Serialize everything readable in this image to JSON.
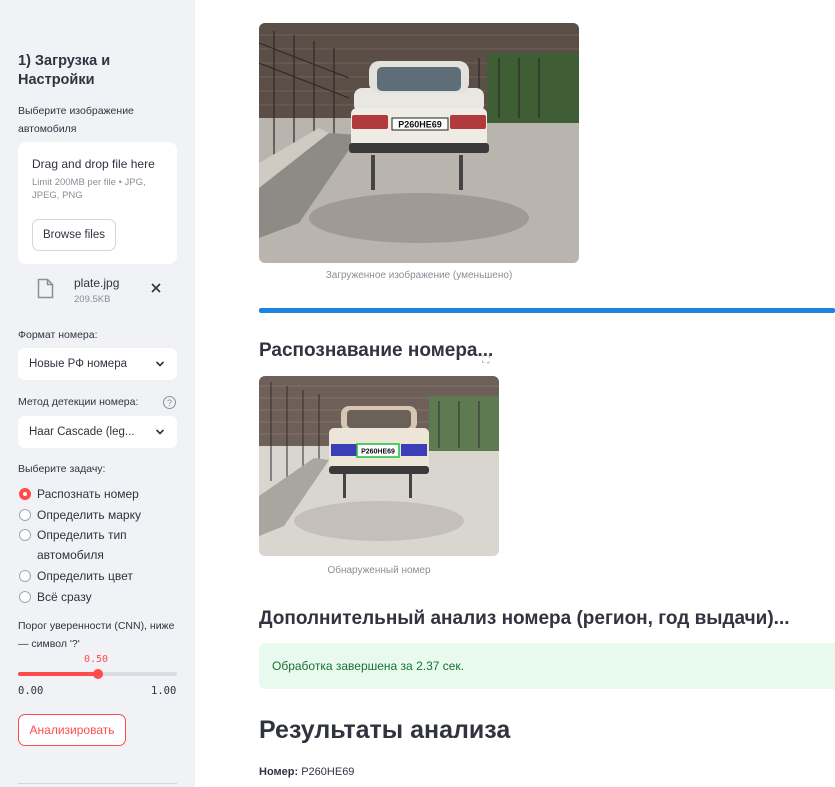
{
  "sidebar": {
    "title": "1) Загрузка и Настройки",
    "upload_label": "Выберите изображение автомобиля",
    "uploader": {
      "drop_text": "Drag and drop file here",
      "limit_text": "Limit 200MB per file • JPG, JPEG, PNG",
      "browse_label": "Browse files"
    },
    "file": {
      "name": "plate.jpg",
      "size": "209.5KB"
    },
    "format_label": "Формат номера:",
    "format_value": "Новые РФ номера",
    "method_label": "Метод детекции номера:",
    "method_value": "Haar Cascade (leg...",
    "help_glyph": "?",
    "task_label": "Выберите задачу:",
    "tasks": [
      {
        "label": "Распознать номер",
        "selected": true
      },
      {
        "label": "Определить марку",
        "selected": false
      },
      {
        "label": "Определить тип автомобиля",
        "selected": false
      },
      {
        "label": "Определить цвет",
        "selected": false
      },
      {
        "label": "Всё сразу",
        "selected": false
      }
    ],
    "threshold_label": "Порог уверенности (CNN), ниже — символ '?'",
    "slider": {
      "value": 0.5,
      "value_text": "0.50",
      "min_text": "0.00",
      "max_text": "1.00"
    },
    "analyze_label": "Анализировать"
  },
  "main": {
    "uploaded_caption": "Загруженное изображение (уменьшено)",
    "recognition_heading": "Распознавание номера...",
    "detected_caption": "Обнаруженный номер",
    "plate_text_img": "Р260НЕ69",
    "extra_heading": "Дополнительный анализ номера (регион, год выдачи)...",
    "success_text": "Обработка завершена за 2.37 сек.",
    "results_heading": "Результаты анализа",
    "result_label": "Номер:",
    "result_value": "Р260НЕ69"
  },
  "colors": {
    "accent": "#ff4b4b",
    "progress": "#1c83e1",
    "success_bg": "#e8f9ee",
    "success_text": "#177233",
    "sidebar_bg": "#f0f2f6"
  }
}
